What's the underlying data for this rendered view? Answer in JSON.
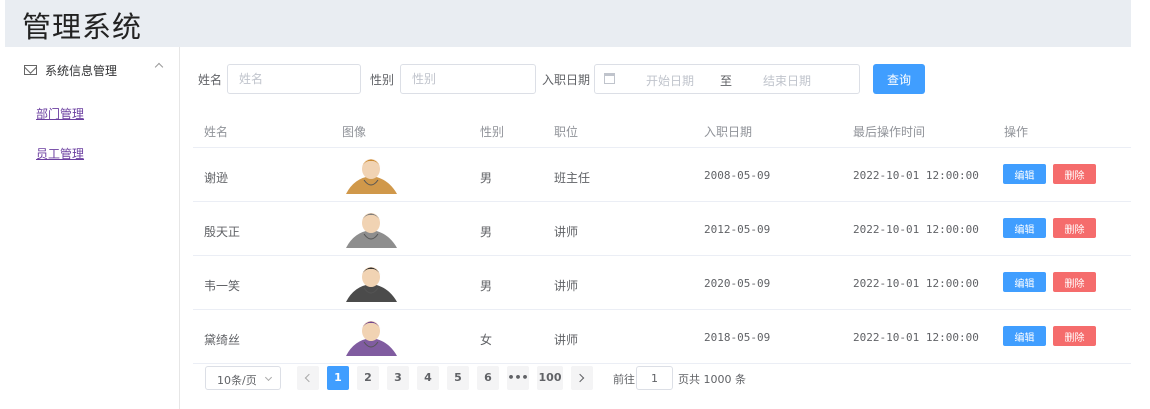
{
  "app": {
    "title": "管理系统"
  },
  "sidebar": {
    "menu_title": "系统信息管理",
    "items": [
      {
        "label": "部门管理"
      },
      {
        "label": "员工管理"
      }
    ]
  },
  "filters": {
    "name_label": "姓名",
    "name_placeholder": "姓名",
    "gender_label": "性别",
    "gender_placeholder": "性别",
    "entry_date_label": "入职日期",
    "start_placeholder": "开始日期",
    "range_separator": "至",
    "end_placeholder": "结束日期",
    "query_label": "查询"
  },
  "table": {
    "headers": [
      "姓名",
      "图像",
      "性别",
      "职位",
      "入职日期",
      "最后操作时间",
      "操作"
    ],
    "rows": [
      {
        "name": "谢逊",
        "gender": "男",
        "position": "班主任",
        "entry_date": "2008-05-09",
        "updated": "2022-10-01 12:00:00",
        "avatar_color": "#c8862a"
      },
      {
        "name": "殷天正",
        "gender": "男",
        "position": "讲师",
        "entry_date": "2012-05-09",
        "updated": "2022-10-01 12:00:00",
        "avatar_color": "#7a7a7a"
      },
      {
        "name": "韦一笑",
        "gender": "男",
        "position": "讲师",
        "entry_date": "2020-05-09",
        "updated": "2022-10-01 12:00:00",
        "avatar_color": "#2b2b2b"
      },
      {
        "name": "黛绮丝",
        "gender": "女",
        "position": "讲师",
        "entry_date": "2018-05-09",
        "updated": "2022-10-01 12:00:00",
        "avatar_color": "#6a3f8f"
      }
    ],
    "edit_label": "编辑",
    "delete_label": "删除"
  },
  "pagination": {
    "page_size": "10条/页",
    "pages": [
      "1",
      "2",
      "3",
      "4",
      "5",
      "6",
      "•••",
      "100"
    ],
    "current": "1",
    "goto_label": "前往",
    "goto_value": "1",
    "total_text": "页共 1000 条"
  },
  "colors": {
    "primary": "#409eff",
    "danger": "#f56c6c",
    "header_bg": "#e9edf2"
  }
}
